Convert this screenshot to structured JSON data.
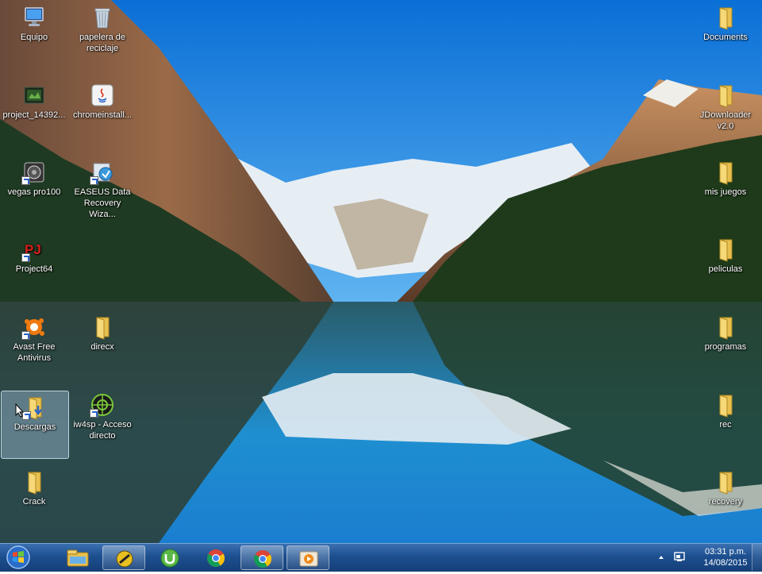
{
  "desktop": {
    "icons": [
      {
        "label": "Equipo",
        "icon": "computer-icon"
      },
      {
        "label": "papelera de reciclaje",
        "icon": "recycle-bin-icon"
      },
      {
        "label": "project_14392...",
        "icon": "video-file-icon"
      },
      {
        "label": "chromeinstall...",
        "icon": "java-installer-icon"
      },
      {
        "label": "vegas pro100",
        "icon": "vegas-pro-icon"
      },
      {
        "label": "EASEUS Data Recovery Wiza...",
        "icon": "easeus-icon"
      },
      {
        "label": "Project64",
        "icon": "project64-icon"
      },
      {
        "label": "Avast Free Antivirus",
        "icon": "avast-icon"
      },
      {
        "label": "direcx",
        "icon": "folder-icon"
      },
      {
        "label": "Descargas",
        "icon": "downloads-folder-icon",
        "selected": true
      },
      {
        "label": "iw4sp - Acceso directo",
        "icon": "iw4sp-icon"
      },
      {
        "label": "Crack",
        "icon": "folder-icon"
      },
      {
        "label": "Documents",
        "icon": "folder-icon"
      },
      {
        "label": "JDownloader v2.0",
        "icon": "folder-icon"
      },
      {
        "label": "mis juegos",
        "icon": "folder-icon"
      },
      {
        "label": "peliculas",
        "icon": "folder-icon"
      },
      {
        "label": "programas",
        "icon": "folder-icon"
      },
      {
        "label": "rec",
        "icon": "folder-icon"
      },
      {
        "label": "recovery",
        "icon": "folder-icon"
      }
    ]
  },
  "taskbar": {
    "start": {
      "icon": "windows-start-orb-icon"
    },
    "pinned": [
      {
        "icon": "file-explorer-icon",
        "active": false
      },
      {
        "icon": "media-app-icon",
        "active": true
      },
      {
        "icon": "utorrent-icon",
        "active": false
      },
      {
        "icon": "chrome-icon",
        "active": false
      },
      {
        "icon": "chrome-icon",
        "active": true
      },
      {
        "icon": "media-player-icon",
        "active": true
      }
    ],
    "tray": {
      "time": "03:31 p.m.",
      "date": "14/08/2015"
    }
  },
  "colors": {
    "taskbar": "#1d4f8f",
    "selection": "#bedcff"
  }
}
